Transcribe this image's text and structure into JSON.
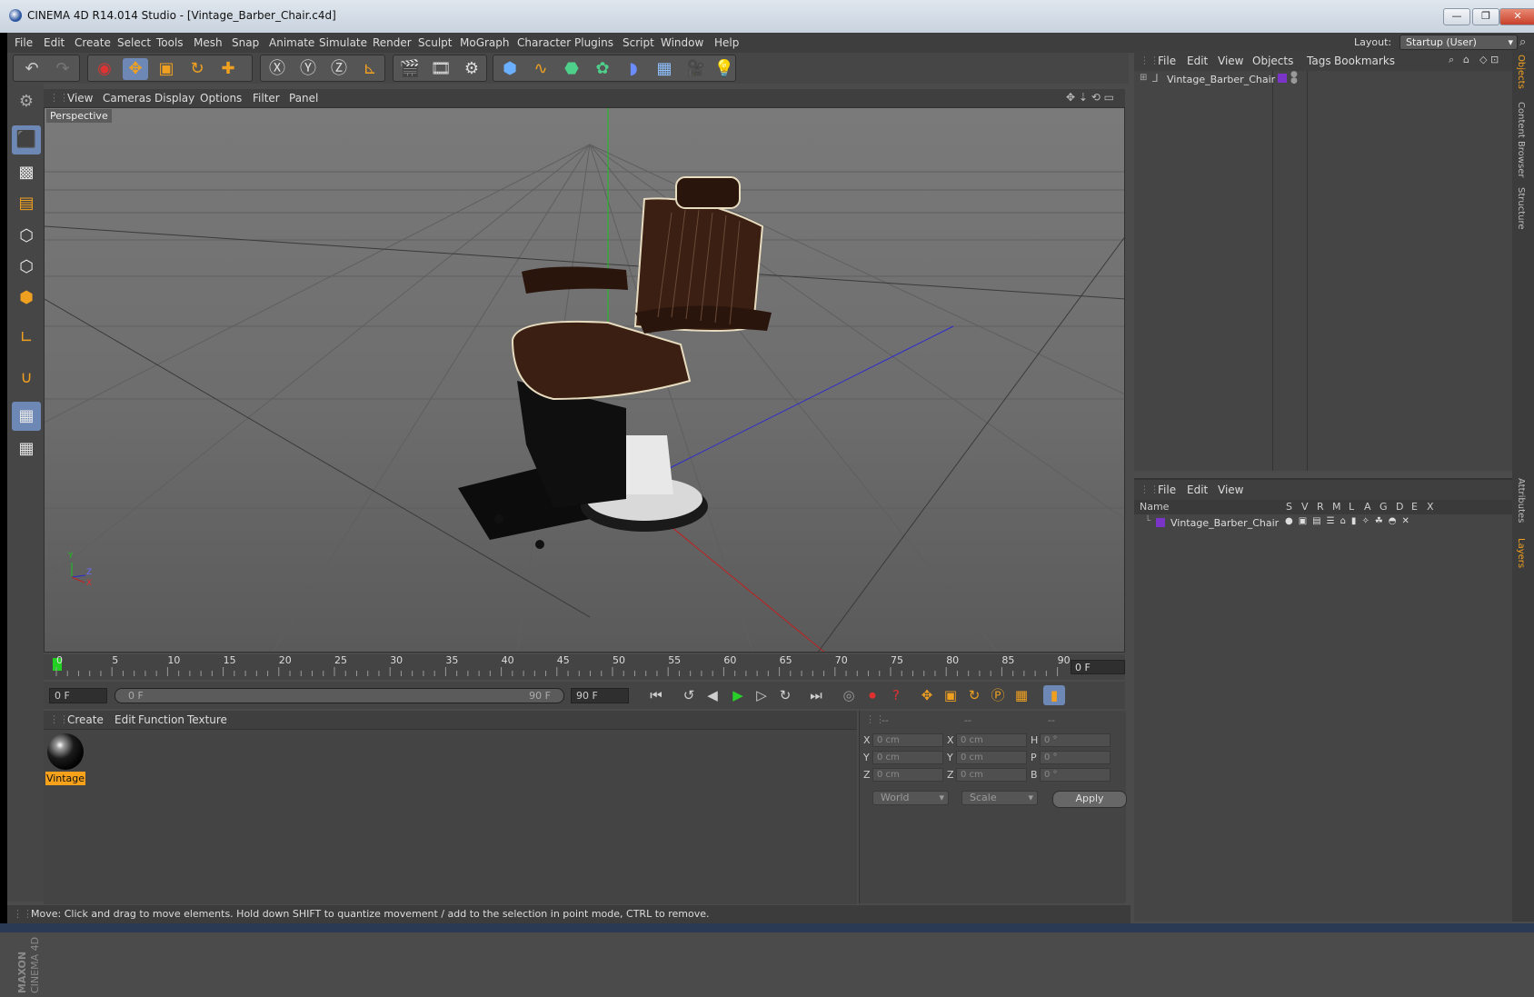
{
  "window": {
    "title": "CINEMA 4D R14.014 Studio - [Vintage_Barber_Chair.c4d]",
    "minimize_glyph": "—",
    "restore_glyph": "❐",
    "close_glyph": "✕"
  },
  "menu": {
    "items": [
      "File",
      "Edit",
      "Create",
      "Select",
      "Tools",
      "Mesh",
      "Snap",
      "Animate",
      "Simulate",
      "Render",
      "Sculpt",
      "MoGraph",
      "Character",
      "Plugins",
      "Script",
      "Window",
      "Help"
    ],
    "layout_label": "Layout:",
    "layout_value": "Startup (User)"
  },
  "viewport": {
    "menu": [
      "View",
      "Cameras",
      "Display",
      "Options",
      "Filter",
      "Panel"
    ],
    "label": "Perspective",
    "axis_y": "Y",
    "axis_x": "X",
    "axis_z": "Z"
  },
  "timeline": {
    "ticks": [
      "0",
      "5",
      "10",
      "15",
      "20",
      "25",
      "30",
      "35",
      "40",
      "45",
      "50",
      "55",
      "60",
      "65",
      "70",
      "75",
      "80",
      "85",
      "90"
    ],
    "current_frame": "0 F"
  },
  "transport": {
    "start_field": "0 F",
    "range_start": "0 F",
    "range_end": "90 F",
    "end_field": "90 F"
  },
  "materials": {
    "menu": [
      "Create",
      "Edit",
      "Function",
      "Texture"
    ],
    "items": [
      {
        "label": "Vintage"
      }
    ]
  },
  "coordinates": {
    "headers": [
      "--",
      "--",
      "--"
    ],
    "rows": [
      {
        "l1": "X",
        "v1": "0 cm",
        "l2": "X",
        "v2": "0 cm",
        "l3": "H",
        "v3": "0 °"
      },
      {
        "l1": "Y",
        "v1": "0 cm",
        "l2": "Y",
        "v2": "0 cm",
        "l3": "P",
        "v3": "0 °"
      },
      {
        "l1": "Z",
        "v1": "0 cm",
        "l2": "Z",
        "v2": "0 cm",
        "l3": "B",
        "v3": "0 °"
      }
    ],
    "mode_dropdown": "World",
    "type_dropdown": "Scale",
    "apply_label": "Apply"
  },
  "status": {
    "text": "Move: Click and drag to move elements. Hold down SHIFT to quantize movement / add to the selection in point mode, CTRL to remove."
  },
  "objects": {
    "menu": [
      "File",
      "Edit",
      "View",
      "Objects",
      "Tags",
      "Bookmarks"
    ],
    "items": [
      {
        "name": "Vintage_Barber_Chair",
        "layer_color": "#7a35c8"
      }
    ]
  },
  "layers": {
    "menu": [
      "File",
      "Edit",
      "View"
    ],
    "columns": [
      "Name",
      "S",
      "V",
      "R",
      "M",
      "L",
      "A",
      "G",
      "D",
      "E",
      "X"
    ],
    "items": [
      {
        "name": "Vintage_Barber_Chair",
        "color": "#7a35c8"
      }
    ]
  },
  "side_tabs": [
    "Objects",
    "Content Browser",
    "Structure",
    "Attributes",
    "Layers"
  ],
  "logo": {
    "line1": "MAXON",
    "line2": "CINEMA 4D"
  },
  "colors": {
    "accent_orange": "#f0a020",
    "selection_blue": "#6e88b6",
    "highlight_label": "#f7a21a"
  }
}
